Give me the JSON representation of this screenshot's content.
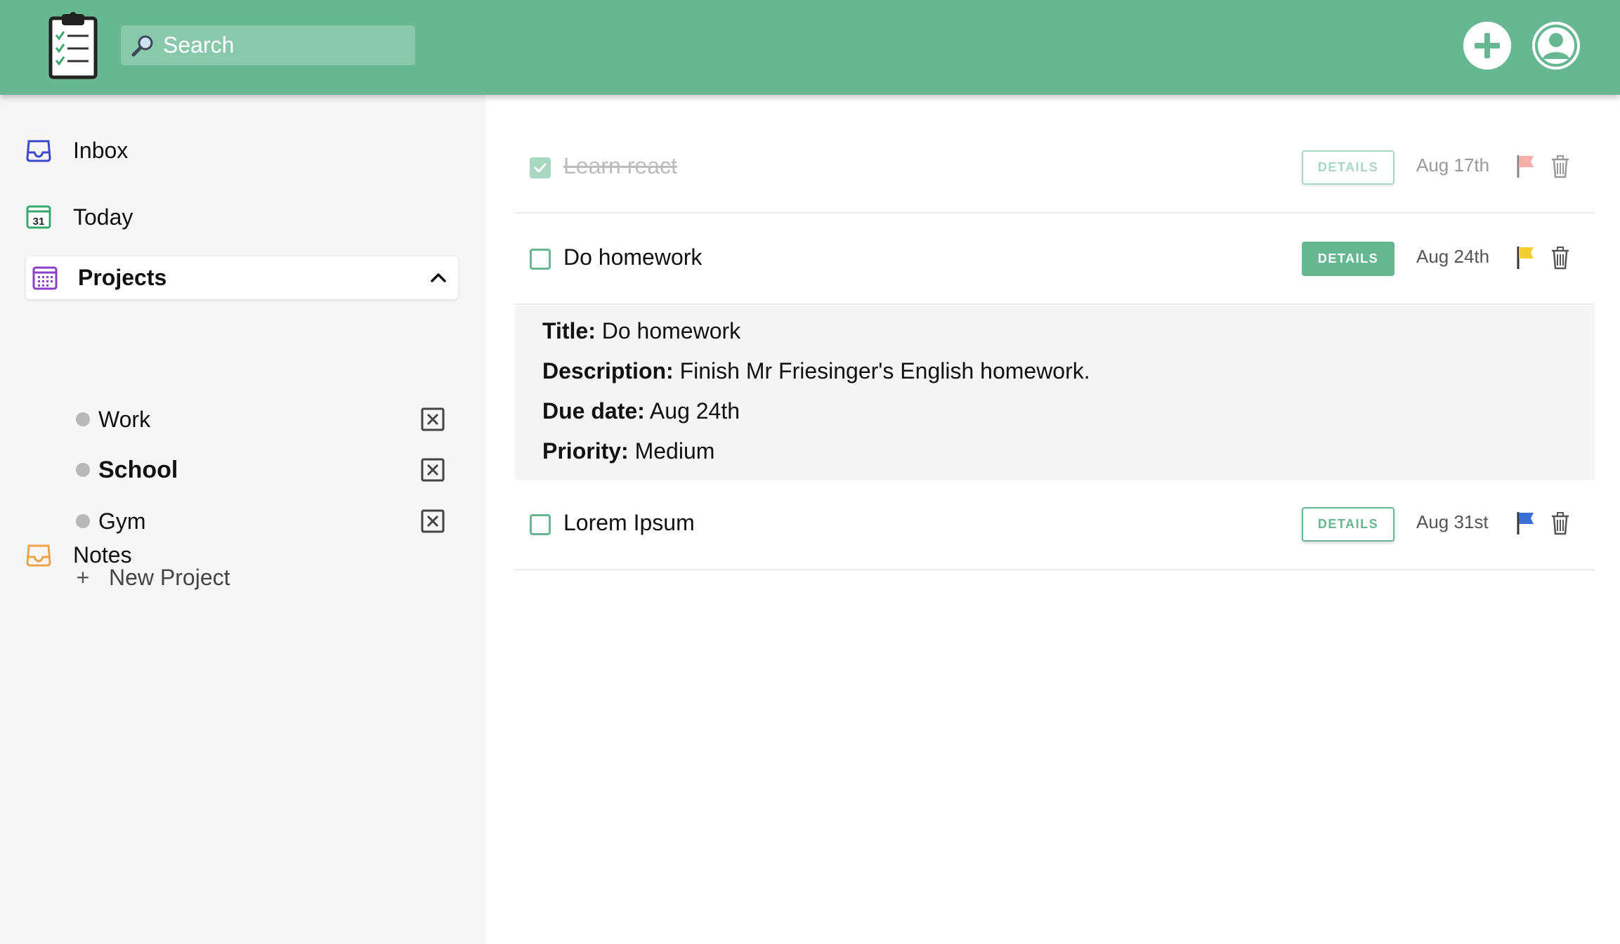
{
  "header": {
    "search": {
      "placeholder": "Search",
      "value": ""
    },
    "colors": {
      "brand": "#66b792",
      "search_bg": "#89c8ab"
    }
  },
  "sidebar": {
    "inbox_label": "Inbox",
    "today_label": "Today",
    "today_icon_text": "31",
    "projects_label": "Projects",
    "projects": [
      {
        "name": "Work",
        "selected": false
      },
      {
        "name": "School",
        "selected": true
      },
      {
        "name": "Gym",
        "selected": false
      }
    ],
    "new_project_label": "New Project",
    "new_project_icon": "+",
    "notes_label": "Notes"
  },
  "tasks": [
    {
      "title": "Learn react",
      "completed": true,
      "details_label": "DETAILS",
      "due": "Aug 17th",
      "flag_color": "#ee7b73",
      "details_open": false
    },
    {
      "title": "Do homework",
      "completed": false,
      "details_label": "DETAILS",
      "due": "Aug 24th",
      "flag_color": "#f2cf32",
      "details_open": true
    },
    {
      "title": "Lorem Ipsum",
      "completed": false,
      "details_label": "DETAILS",
      "due": "Aug 31st",
      "flag_color": "#3c6fd6",
      "details_open": false
    }
  ],
  "details": {
    "title_label": "Title:",
    "title_value": "Do homework",
    "description_label": "Description:",
    "description_value": "Finish Mr Friesinger's English homework.",
    "due_label": "Due date:",
    "due_value": "Aug 24th",
    "priority_label": "Priority:",
    "priority_value": "Medium"
  },
  "icons": {
    "logo": "clipboard-checklist-icon",
    "search": "magnifier-icon",
    "add": "plus-circle-icon",
    "account": "user-avatar-icon",
    "inbox": "inbox-tray-icon",
    "today": "calendar-day-icon",
    "projects": "calendar-grid-icon",
    "notes": "notes-tray-icon",
    "delete_project": "x-box-icon",
    "flag": "flag-icon",
    "trash": "trash-icon",
    "collapse": "chevron-up-icon"
  }
}
